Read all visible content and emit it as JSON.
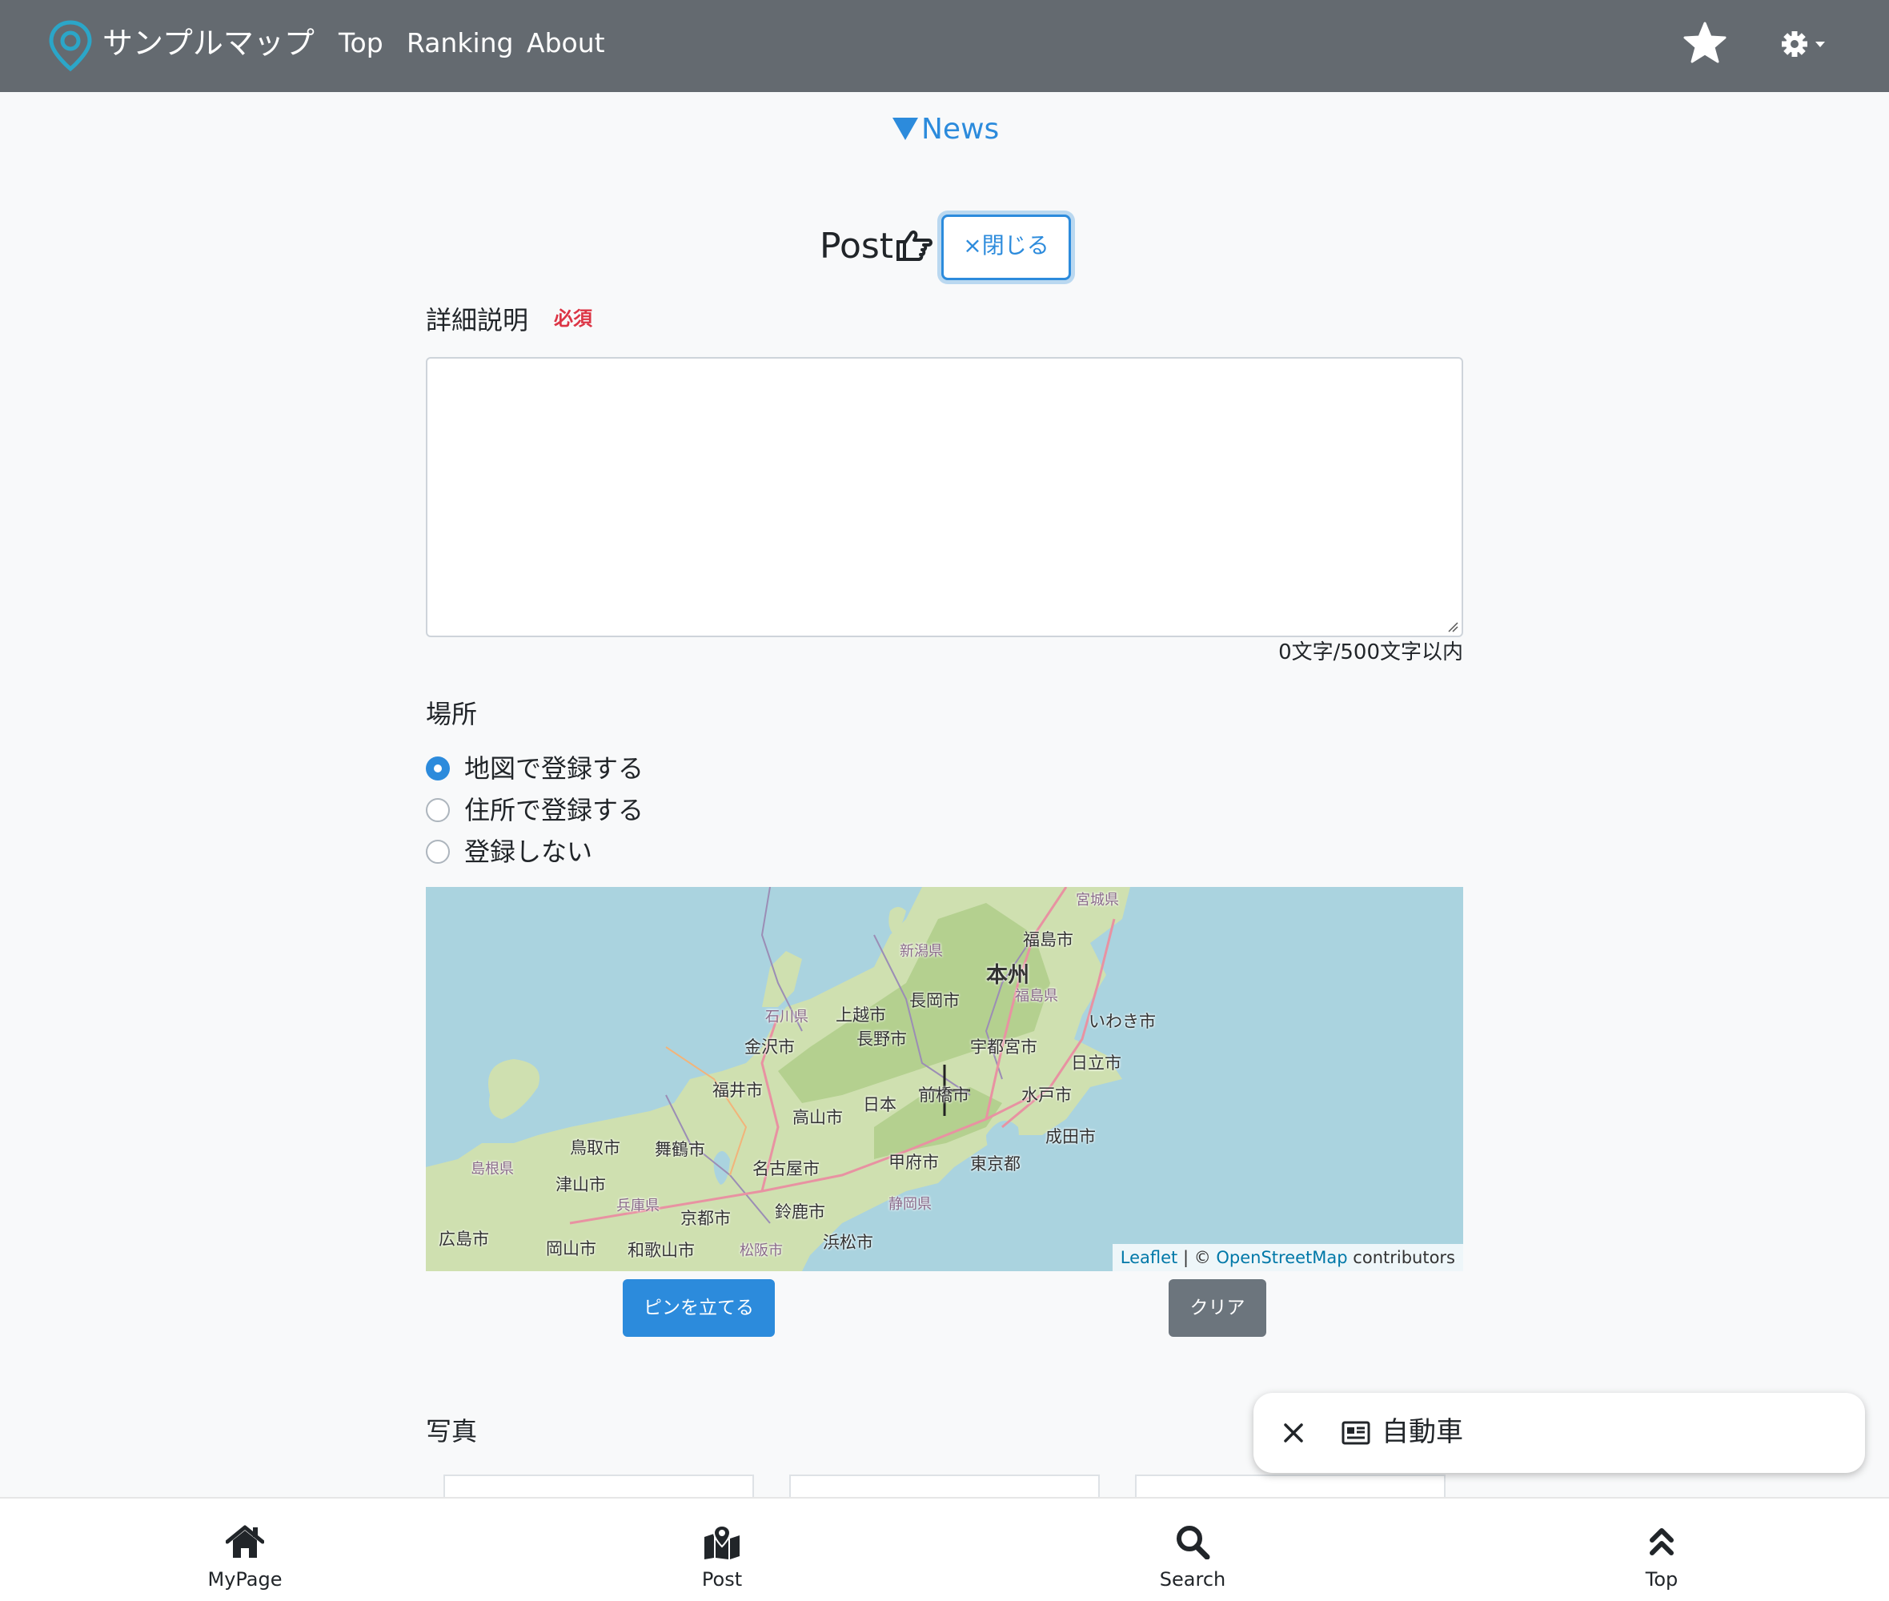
{
  "navbar": {
    "brand": "サンプルマップ",
    "links": [
      "Top",
      "Ranking",
      "About"
    ],
    "favorites_icon": "star-icon",
    "settings_icon": "gear-icon"
  },
  "news": {
    "label": "News"
  },
  "post": {
    "title": "Post",
    "close_label": "×閉じる"
  },
  "description": {
    "label": "詳細説明",
    "required": "必須",
    "value": "",
    "counter": "0文字/500文字以内"
  },
  "location": {
    "label": "場所",
    "options": [
      "地図で登録する",
      "住所で登録する",
      "登録しない"
    ],
    "selected": "地図で登録する"
  },
  "map": {
    "labels": {
      "miyagi": "宮城県",
      "fukushima_city": "福島市",
      "niigata": "新潟県",
      "honshu": "本州",
      "nagaoka": "長岡市",
      "fukushima_pref": "福島県",
      "iwaki": "いわき市",
      "ishikawa": "石川県",
      "joetsu": "上越市",
      "kanazawa": "金沢市",
      "nagano": "長野市",
      "utsunomiya": "宇都宮市",
      "hitachi": "日立市",
      "fukui": "福井市",
      "nihon": "日本",
      "maebashi": "前橋市",
      "mito": "水戸市",
      "takayama": "高山市",
      "narita": "成田市",
      "tottori": "鳥取市",
      "maizuru": "舞鶴市",
      "shimane": "島根県",
      "nagoya": "名古屋市",
      "kofu": "甲府市",
      "tokyo": "東京都",
      "tsuyama": "津山市",
      "hyogo": "兵庫県",
      "kyoto": "京都市",
      "suzuka": "鈴鹿市",
      "shizuoka": "静岡県",
      "hiroshima": "広島市",
      "okayama": "岡山市",
      "wakayama": "和歌山市",
      "matsusaka": "松阪市",
      "hamamatsu": "浜松市"
    },
    "attribution": {
      "leaflet": "Leaflet",
      "separator": "| ©",
      "osm": "OpenStreetMap",
      "contributors": "contributors"
    }
  },
  "buttons": {
    "pin": "ピンを立てる",
    "clear": "クリア"
  },
  "photo": {
    "label": "写真"
  },
  "chip": {
    "text": "自動車",
    "close_icon": "close-icon",
    "icon": "newspaper-icon"
  },
  "bottom_nav": [
    {
      "label": "MyPage",
      "icon": "home-icon"
    },
    {
      "label": "Post",
      "icon": "map-marked-icon"
    },
    {
      "label": "Search",
      "icon": "search-icon"
    },
    {
      "label": "Top",
      "icon": "chevron-double-up-icon"
    }
  ],
  "colors": {
    "navbar": "#646a70",
    "primary": "#2c8bdc",
    "secondary": "#6c757d",
    "danger": "#dc3545",
    "brand_icon": "#2ba6c8",
    "sea": "#aad3df",
    "land": "#cfe0b0"
  }
}
